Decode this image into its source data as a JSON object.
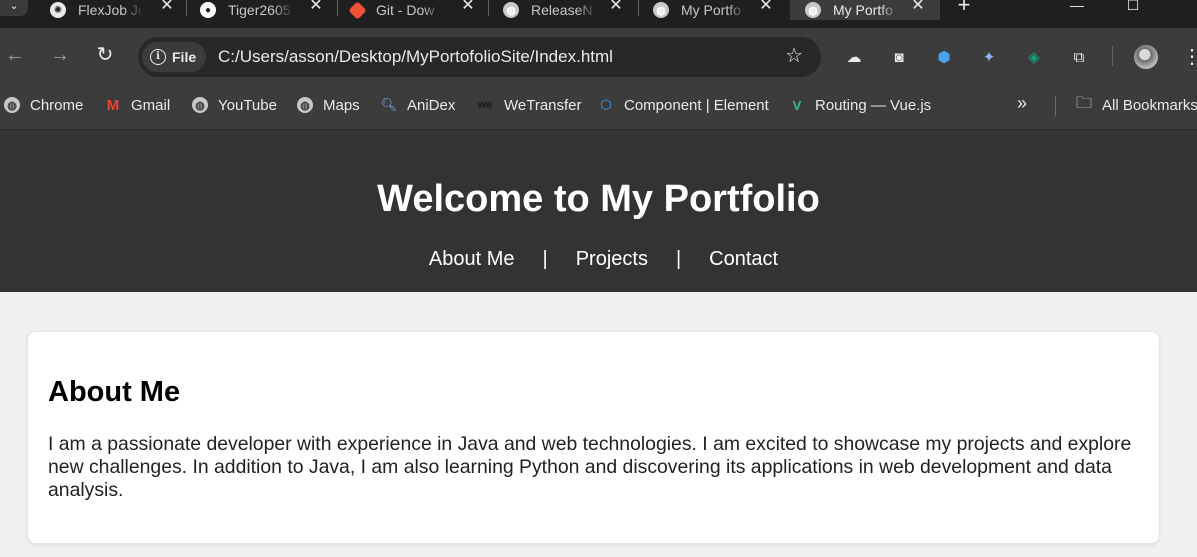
{
  "tabs": [
    {
      "title": "FlexJob Jo",
      "icon": "chatgpt-icon"
    },
    {
      "title": "Tiger2605",
      "icon": "github-icon"
    },
    {
      "title": "Git - Dow",
      "icon": "git-icon"
    },
    {
      "title": "ReleaseN",
      "icon": "globe-icon"
    },
    {
      "title": "My Portfo",
      "icon": "globe-icon"
    },
    {
      "title": "My Portfo",
      "icon": "globe-icon",
      "active": true
    }
  ],
  "address_bar": {
    "chip_label": "File",
    "url": "C:/Users/asson/Desktop/MyPortofolioSite/Index.html"
  },
  "bookmarks": [
    {
      "label": "Chrome",
      "icon": "globe-icon"
    },
    {
      "label": "Gmail",
      "icon": "gmail-icon"
    },
    {
      "label": "YouTube",
      "icon": "globe-icon"
    },
    {
      "label": "Maps",
      "icon": "globe-icon"
    },
    {
      "label": "AniDex",
      "icon": "search-icon"
    },
    {
      "label": "WeTransfer",
      "icon": "wetransfer-icon"
    },
    {
      "label": "Component | Element",
      "icon": "element-icon"
    },
    {
      "label": "Routing — Vue.js",
      "icon": "vue-icon"
    }
  ],
  "all_bookmarks_label": "All Bookmarks",
  "site": {
    "title": "Welcome to My Portfolio",
    "nav": {
      "about": "About Me",
      "projects": "Projects",
      "contact": "Contact",
      "separator": "|"
    },
    "about": {
      "heading": "About Me",
      "text": "I am a passionate developer with experience in Java and web technologies. I am excited to showcase my projects and explore new challenges. In addition to Java, I am also learning Python and discovering its applications in web development and data analysis."
    }
  },
  "colors": {
    "site_header_bg": "#333333",
    "page_bg": "#f0f0f0",
    "card_bg": "#ffffff",
    "browser_toolbar": "#3c3c3c"
  }
}
